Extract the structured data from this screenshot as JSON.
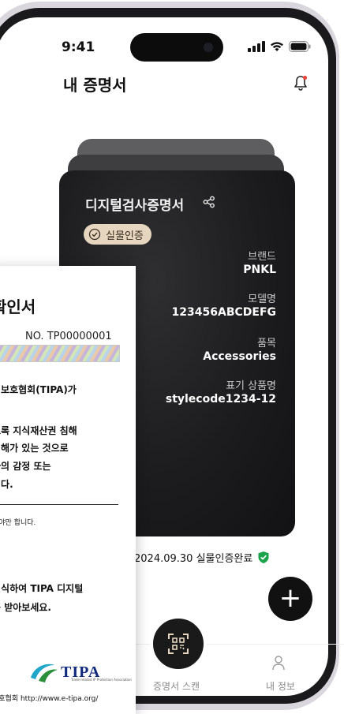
{
  "status_bar": {
    "time": "9:41"
  },
  "header": {
    "title": "내 증명서"
  },
  "card": {
    "title": "디지털검사증명서",
    "badge": "실물인증",
    "fields": [
      {
        "label": "브랜드",
        "value": "PNKL"
      },
      {
        "label": "모델명",
        "value": "123456ABCDEFG"
      },
      {
        "label": "품목",
        "value": "Accessories"
      },
      {
        "label": "표기 상품명",
        "value": "stylecode1234-12"
      }
    ]
  },
  "certification": {
    "text": "2024.09.30 실물인증완료",
    "check_color": "#1aa34a"
  },
  "fab_label": "+",
  "nav": {
    "scan_label": "증명서 스캔",
    "profile_label": "내 정보"
  },
  "document": {
    "title": "확인서",
    "number": "NO. TP00000001",
    "paragraph1": "권보호협회(TIPA)가",
    "paragraph2": [
      "도록 지식재산권 침해",
      "침해가 있는 것으로",
      "자의 감정 또는",
      "니다."
    ],
    "note": "해야만 합니다.",
    "paragraph3": [
      "인식하여 TIPA 디지털",
      "를 받아보세요."
    ],
    "logo_text": "TIPA",
    "logo_subtext": "Trade-related IP Protection Association",
    "footer": "보호협회 http://www.e-tipa.org/"
  },
  "colors": {
    "card_bg": "#1c1c1e",
    "badge_bg": "#e6d6bf",
    "accent_green": "#1aa34a"
  }
}
